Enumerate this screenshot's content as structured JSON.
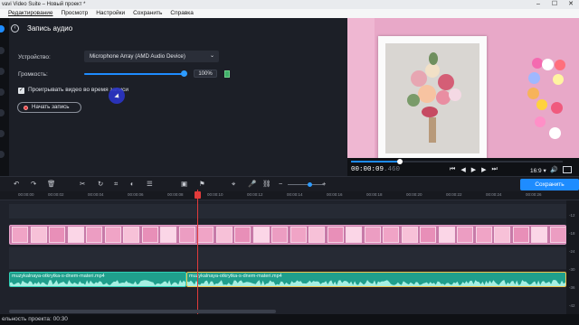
{
  "window": {
    "title": "vavi Video Suite – Новый проект *",
    "controls": [
      "–",
      "☐",
      "✕"
    ]
  },
  "menu": [
    "Редактирование",
    "Просмотр",
    "Настройки",
    "Сохранить",
    "Справка"
  ],
  "panel": {
    "title": "Запись аудио",
    "device_label": "Устройство:",
    "device_value": "Microphone Array (AMD Audio Device)",
    "volume_label": "Громкость:",
    "volume_value": "100%",
    "volume_level": 1.0,
    "play_video_label": "Проигрывать видео во время записи",
    "play_video_checked": true,
    "record_button": "Начать запись"
  },
  "preview": {
    "time_current": "00:00:09",
    "time_frac": ".460",
    "progress": 0.23,
    "aspect_ratio": "16:9 ▾"
  },
  "toolbar": {
    "save_label": "Сохранить"
  },
  "ruler_ticks": [
    "00:00:00",
    "00:00:02",
    "00:00:04",
    "00:00:06",
    "00:00:08",
    "00:00:10",
    "00:00:12",
    "00:00:14",
    "00:00:16",
    "00:00:18",
    "00:00:20",
    "00:00:22",
    "00:00:24",
    "00:00:26"
  ],
  "audio_clips": [
    {
      "name": "muzykalnaya-otkrytka-s-dnem-materi.mp4"
    },
    {
      "name": "muzykalnaya-otkrytka-s-dnem-materi.mp4"
    }
  ],
  "right_scale": [
    "-12",
    "-18",
    "-24",
    "-30",
    "-36",
    "-42"
  ],
  "status": {
    "duration_label": "ельность проекта: 00:30"
  },
  "colors": {
    "accent": "#1e8cff",
    "audio_clip": "#1f9f8c",
    "video_clip": "#c77aa8",
    "playhead": "#e23b3b"
  }
}
